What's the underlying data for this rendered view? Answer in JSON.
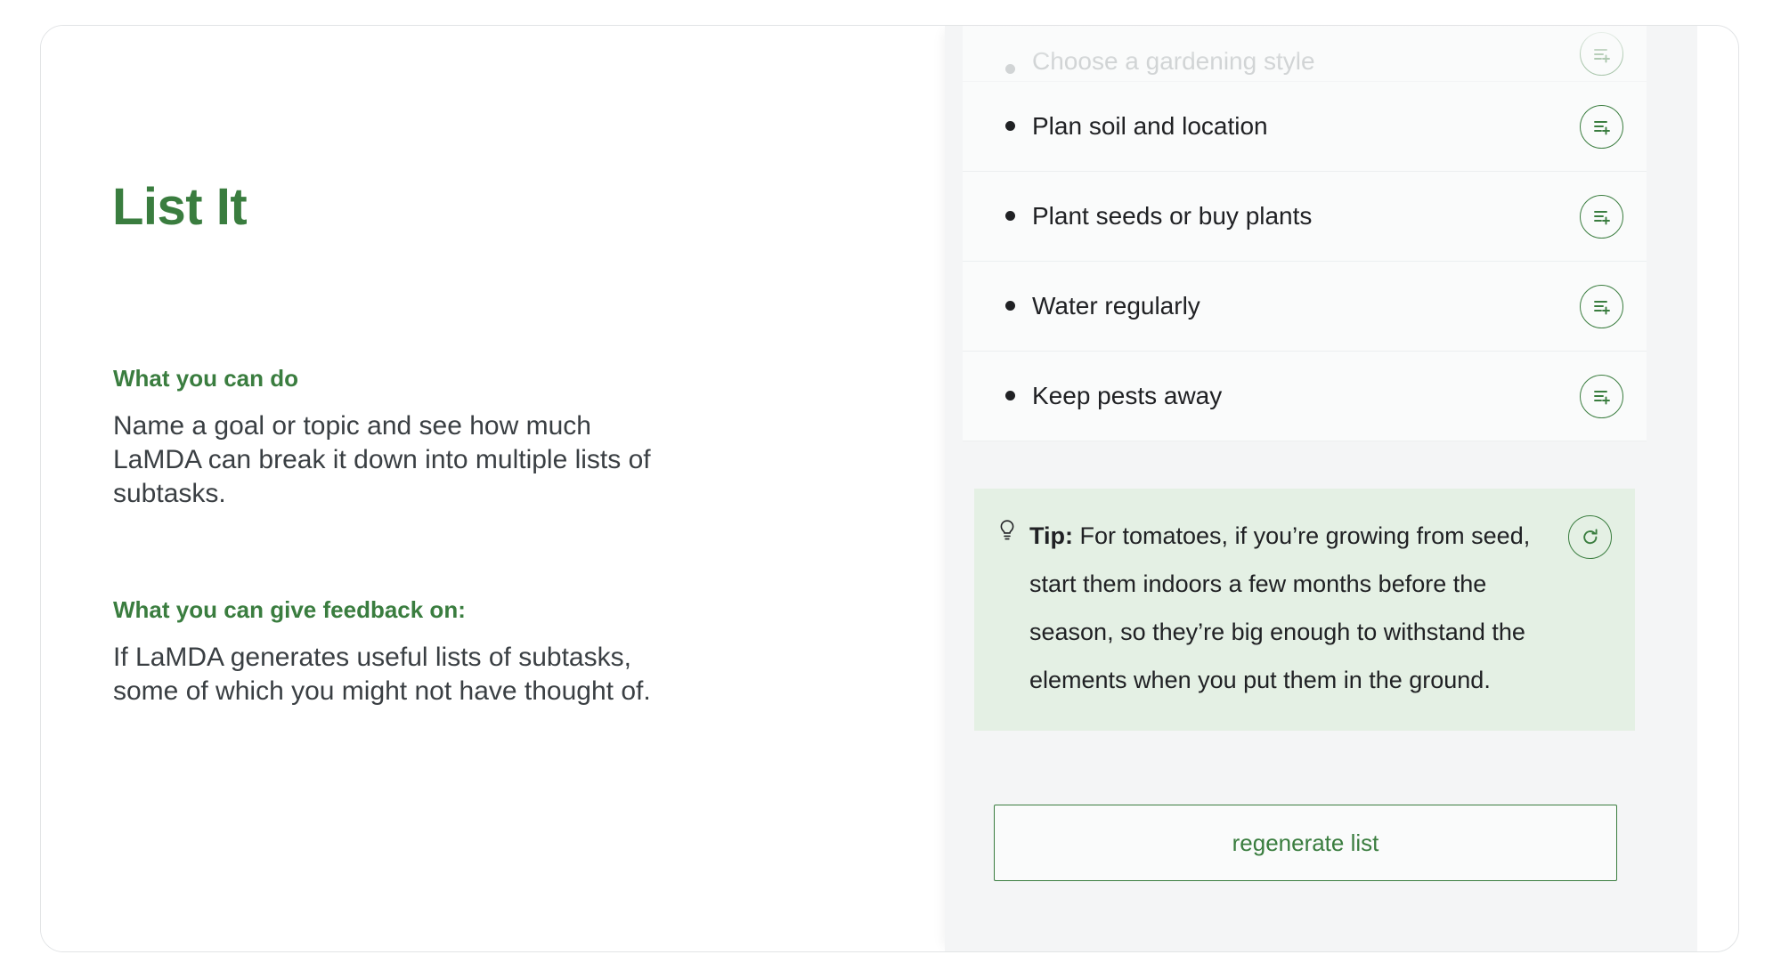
{
  "page": {
    "title": "List It"
  },
  "info": {
    "sections": [
      {
        "heading": "What you can do",
        "body": "Name a goal or topic and see how much LaMDA can break it down into multiple lists of subtasks."
      },
      {
        "heading": "What you can give feedback on:",
        "body": "If LaMDA generates useful lists of subtasks, some of which you might not have thought of."
      }
    ]
  },
  "panel": {
    "tasks": [
      {
        "label": "Choose a gardening style",
        "action_icon": "list-add-icon",
        "dimmed": true
      },
      {
        "label": "Plan soil and location",
        "action_icon": "list-add-icon",
        "dimmed": false
      },
      {
        "label": "Plant seeds or buy plants",
        "action_icon": "list-add-icon",
        "dimmed": false
      },
      {
        "label": "Water regularly",
        "action_icon": "list-add-icon",
        "dimmed": false
      },
      {
        "label": "Keep pests away",
        "action_icon": "list-add-icon",
        "dimmed": false
      }
    ],
    "tip": {
      "icon": "lightbulb-icon",
      "label": "Tip:",
      "text": " For tomatoes, if you’re growing from seed, start them indoors a few months before the season, so they’re big enough to withstand the elements when you put them in the ground.",
      "refresh_icon": "refresh-icon"
    },
    "regenerate_label": "regenerate list"
  },
  "colors": {
    "brand_green": "#3a7d3f",
    "tip_background": "#e4f0e4",
    "panel_background": "#f4f5f6",
    "list_background": "#fafbfb",
    "text_dark": "#202124",
    "text_muted": "#9aa0a3",
    "border": "#e2e4e6"
  }
}
